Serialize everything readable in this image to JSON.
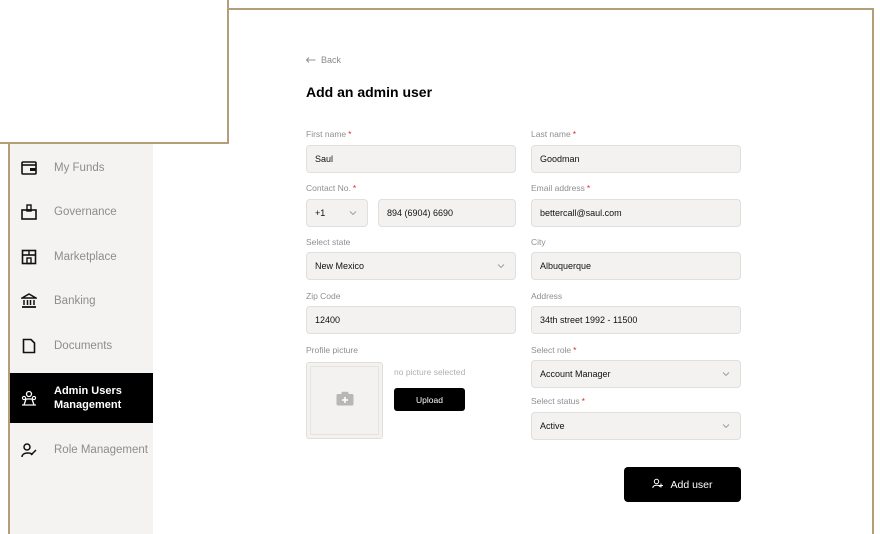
{
  "sidebar": {
    "items": [
      {
        "label": "My Funds",
        "icon": "wallet-icon"
      },
      {
        "label": "Governance",
        "icon": "ballot-box-icon"
      },
      {
        "label": "Marketplace",
        "icon": "store-icon"
      },
      {
        "label": "Banking",
        "icon": "bank-icon"
      },
      {
        "label": "Documents",
        "icon": "document-icon"
      },
      {
        "label": "Admin Users Management",
        "label_line1": "Admin Users",
        "label_line2": "Management",
        "icon": "admin-users-icon",
        "active": true
      },
      {
        "label": "Role Management",
        "icon": "role-icon"
      }
    ]
  },
  "page": {
    "back_label": "Back",
    "title": "Add  an admin user"
  },
  "form": {
    "first_name": {
      "label": "First name",
      "value": "Saul"
    },
    "last_name": {
      "label": "Last name",
      "value": "Goodman"
    },
    "contact": {
      "label": "Contact No.",
      "country_code": "+1",
      "value": "894 (6904) 6690"
    },
    "email": {
      "label": "Email address",
      "value": "bettercall@saul.com"
    },
    "state": {
      "label": "Select state",
      "value": "New Mexico"
    },
    "city": {
      "label": "City",
      "value": "Albuquerque"
    },
    "zip": {
      "label": "Zip Code",
      "value": "12400"
    },
    "address": {
      "label": "Address",
      "value": "34th street 1992 - 11500"
    },
    "picture": {
      "label": "Profile picture",
      "status": "no picture selected",
      "upload_label": "Upload"
    },
    "role": {
      "label": "Select role",
      "value": "Account Manager"
    },
    "status": {
      "label": "Select status",
      "value": "Active"
    },
    "required_mark": "*",
    "submit_label": "Add user"
  },
  "colors": {
    "frame": "#b39e79",
    "sidebar_bg": "#f4f3f1",
    "field_bg": "#f3f2f0",
    "primary": "#000000",
    "required": "#d32f2f"
  }
}
